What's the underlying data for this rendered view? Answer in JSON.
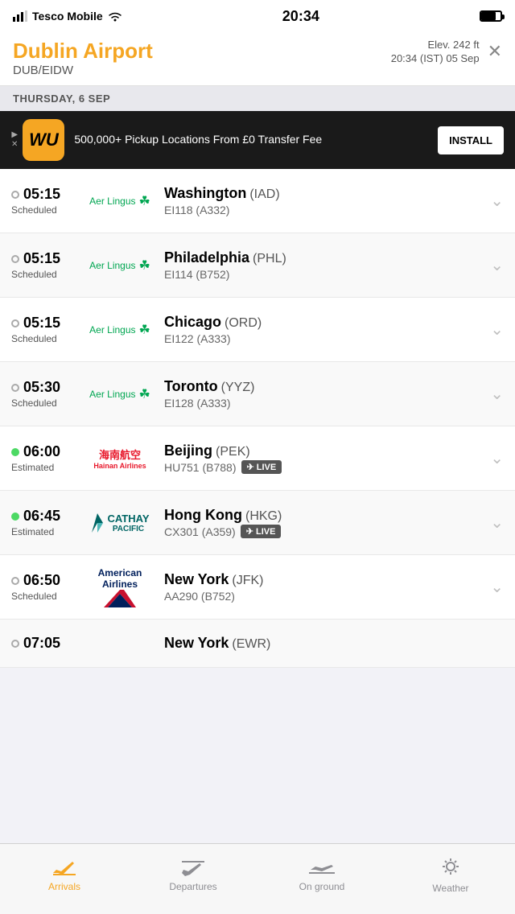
{
  "statusBar": {
    "carrier": "Tesco Mobile",
    "time": "20:34",
    "wifi": true,
    "battery": 75
  },
  "header": {
    "airportName": "Dublin Airport",
    "airportCode": "DUB/EIDW",
    "elevation": "Elev. 242 ft",
    "datetime": "20:34 (IST) 05 Sep",
    "closeLabel": "✕"
  },
  "dateBar": {
    "label": "THURSDAY, 6 SEP"
  },
  "ad": {
    "logo": "WU",
    "text": "500,000+ Pickup Locations From £0 Transfer Fee",
    "installLabel": "INSTALL"
  },
  "flights": [
    {
      "time": "05:15",
      "status": "Scheduled",
      "dotColor": "gray",
      "airline": "Aer Lingus",
      "airlineType": "aerlingus",
      "destination": "Washington",
      "destCode": "IAD",
      "flightNum": "EI118",
      "aircraft": "A332",
      "live": false
    },
    {
      "time": "05:15",
      "status": "Scheduled",
      "dotColor": "gray",
      "airline": "Aer Lingus",
      "airlineType": "aerlingus",
      "destination": "Philadelphia",
      "destCode": "PHL",
      "flightNum": "EI114",
      "aircraft": "B752",
      "live": false
    },
    {
      "time": "05:15",
      "status": "Scheduled",
      "dotColor": "gray",
      "airline": "Aer Lingus",
      "airlineType": "aerlingus",
      "destination": "Chicago",
      "destCode": "ORD",
      "flightNum": "EI122",
      "aircraft": "A333",
      "live": false
    },
    {
      "time": "05:30",
      "status": "Scheduled",
      "dotColor": "gray",
      "airline": "Aer Lingus",
      "airlineType": "aerlingus",
      "destination": "Toronto",
      "destCode": "YYZ",
      "flightNum": "EI128",
      "aircraft": "A333",
      "live": false
    },
    {
      "time": "06:00",
      "status": "Estimated",
      "dotColor": "green",
      "airline": "Hainan Airlines",
      "airlineType": "hainan",
      "destination": "Beijing",
      "destCode": "PEK",
      "flightNum": "HU751",
      "aircraft": "B788",
      "live": true
    },
    {
      "time": "06:45",
      "status": "Estimated",
      "dotColor": "green",
      "airline": "Cathay Pacific",
      "airlineType": "cathay",
      "destination": "Hong Kong",
      "destCode": "HKG",
      "flightNum": "CX301",
      "aircraft": "A359",
      "live": true
    },
    {
      "time": "06:50",
      "status": "Scheduled",
      "dotColor": "gray",
      "airline": "American Airlines",
      "airlineType": "american",
      "destination": "New York",
      "destCode": "JFK",
      "flightNum": "AA290",
      "aircraft": "B752",
      "live": false
    },
    {
      "time": "07:05",
      "status": "",
      "dotColor": "gray",
      "airline": "",
      "airlineType": "",
      "destination": "New York",
      "destCode": "EWR",
      "flightNum": "",
      "aircraft": "",
      "live": false,
      "partial": true
    }
  ],
  "tabs": [
    {
      "id": "arrivals",
      "label": "Arrivals",
      "icon": "✈",
      "active": true,
      "iconType": "arrivals"
    },
    {
      "id": "departures",
      "label": "Departures",
      "icon": "✈",
      "active": false,
      "iconType": "departures"
    },
    {
      "id": "onground",
      "label": "On ground",
      "icon": "✈",
      "active": false,
      "iconType": "onground"
    },
    {
      "id": "weather",
      "label": "Weather",
      "icon": "☀",
      "active": false,
      "iconType": "weather"
    }
  ]
}
